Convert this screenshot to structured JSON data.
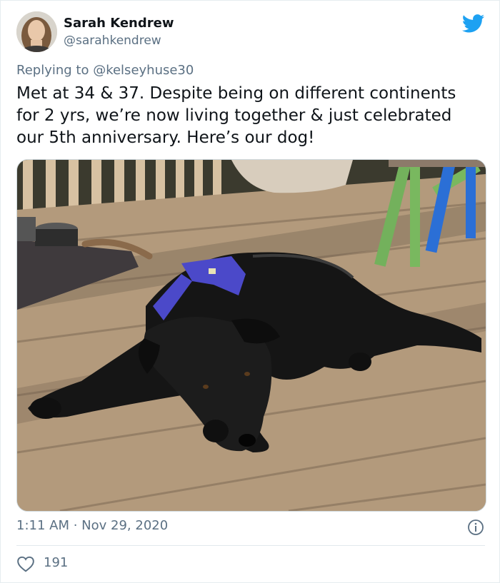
{
  "author": {
    "name": "Sarah Kendrew",
    "handle": "@sarahkendrew"
  },
  "reply": {
    "prefix": "Replying to ",
    "mention": "@kelseyhuse30"
  },
  "tweet": {
    "text": "Met at 34 & 37. Despite being on different continents\nfor 2 yrs, we’re now living together & just celebrated\nour 5th anniversary. Here’s our dog!"
  },
  "meta": {
    "time": "1:11 AM",
    "separator": " · ",
    "date": "Nov 29, 2020"
  },
  "engagement": {
    "likes": "191"
  },
  "icons": {
    "brand": "twitter-bird-icon",
    "info": "info-icon",
    "like": "heart-icon"
  },
  "colors": {
    "brand": "#1da1f2",
    "secondary_text": "#5b7083",
    "primary_text": "#0f1419"
  }
}
